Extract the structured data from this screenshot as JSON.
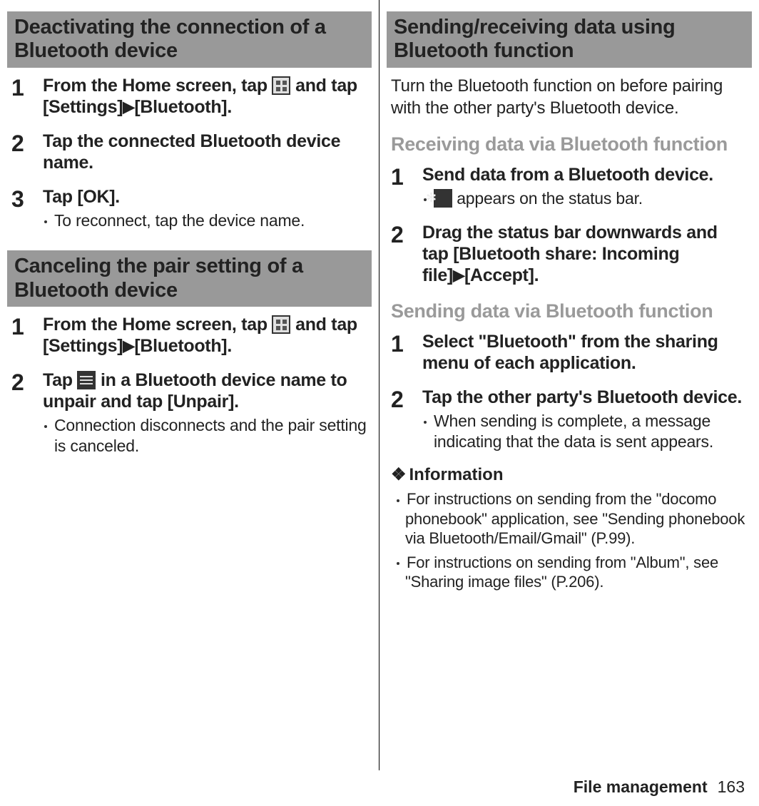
{
  "left": {
    "hdr1": "Deactivating the connection of a Bluetooth device",
    "s1": {
      "num": "1",
      "a": "From the Home screen, tap ",
      "b": " and tap [Settings]",
      "c": "[Bluetooth]."
    },
    "s2": {
      "num": "2",
      "text": "Tap the connected Bluetooth device name."
    },
    "s3": {
      "num": "3",
      "text": "Tap [OK].",
      "note": "To reconnect, tap the device name."
    },
    "hdr2": "Canceling the pair setting of a Bluetooth device",
    "c1": {
      "num": "1",
      "a": "From the Home screen, tap ",
      "b": " and tap [Settings]",
      "c": "[Bluetooth]."
    },
    "c2": {
      "num": "2",
      "a": "Tap ",
      "b": " in a Bluetooth device name to unpair and tap [Unpair].",
      "note": "Connection disconnects and the pair setting is canceled."
    }
  },
  "right": {
    "hdr1": "Sending/receiving data using Bluetooth function",
    "intro": "Turn the Bluetooth function on before pairing with the other party's Bluetooth device.",
    "sub1": "Receiving data via Bluetooth function",
    "r1": {
      "num": "1",
      "text": "Send data from a Bluetooth device.",
      "note": " appears on the status bar."
    },
    "r2": {
      "num": "2",
      "a": "Drag the status bar downwards and tap [Bluetooth share: Incoming file]",
      "b": "[Accept]."
    },
    "sub2": "Sending data via Bluetooth function",
    "sd1": {
      "num": "1",
      "text": "Select \"Bluetooth\" from the sharing menu of each application."
    },
    "sd2": {
      "num": "2",
      "text": "Tap the other party's Bluetooth device.",
      "note": "When sending is complete, a message indicating that the data is sent appears."
    },
    "info_hdr": "Information",
    "info1": "For instructions on sending from the \"docomo phonebook\" application, see \"Sending phonebook via Bluetooth/Email/Gmail\" (P.99).",
    "info2": "For instructions on sending from \"Album\", see \"Sharing image files\" (P.206)."
  },
  "footer": {
    "label": "File management",
    "page": "163"
  }
}
